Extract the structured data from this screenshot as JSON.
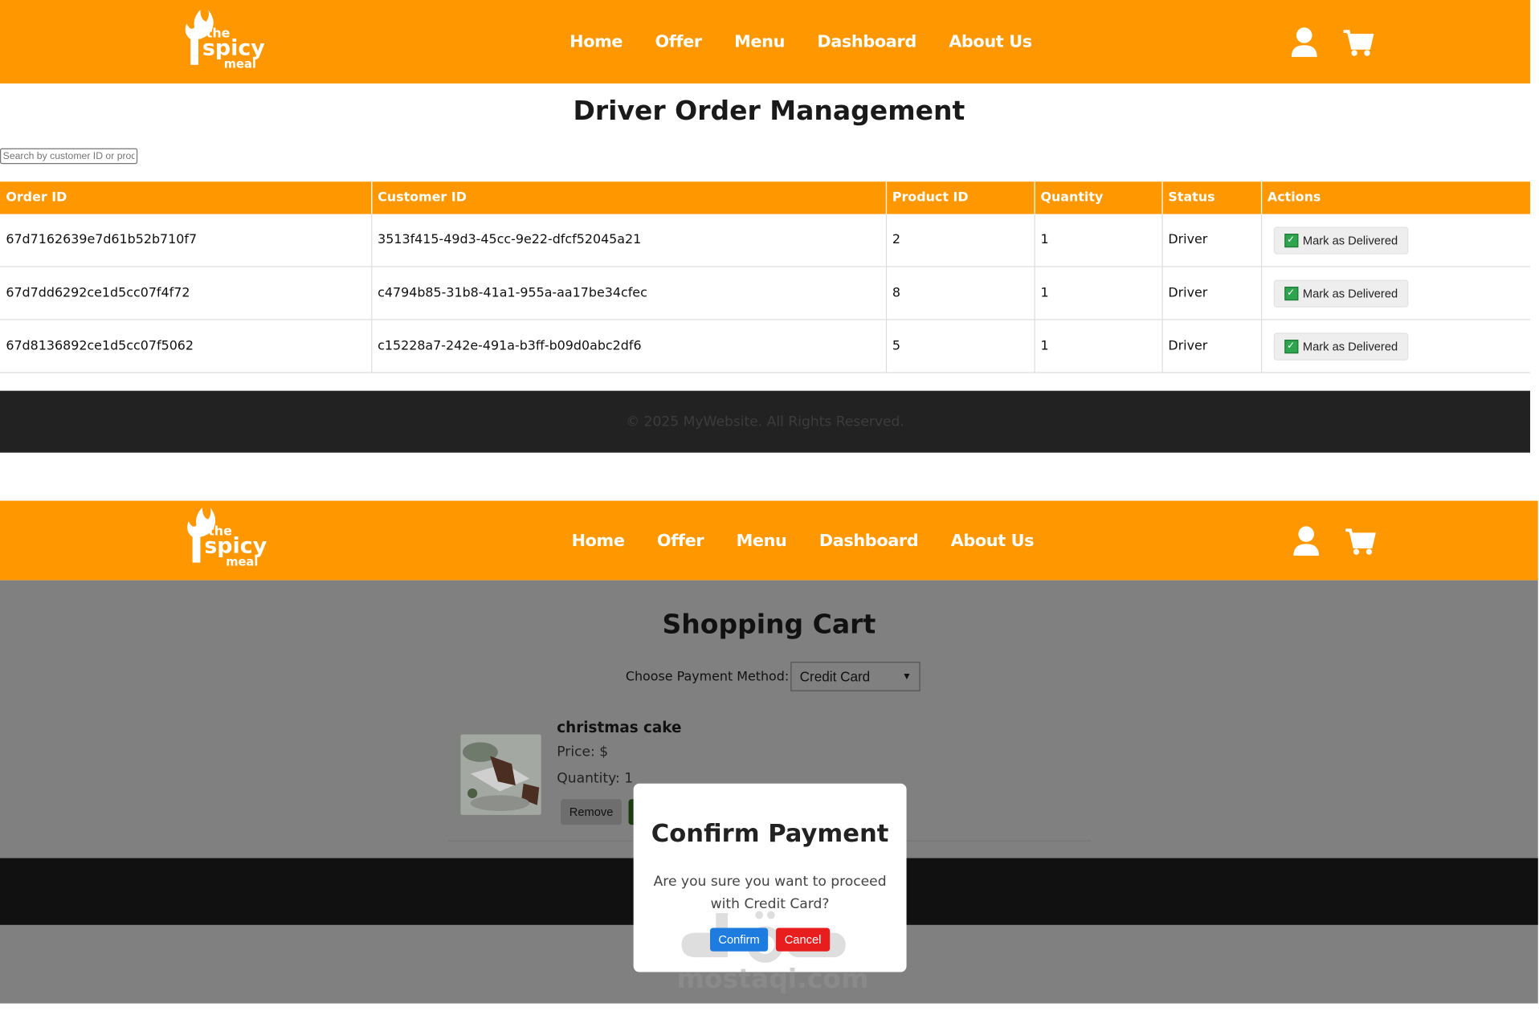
{
  "nav": {
    "links": [
      "Home",
      "Offer",
      "Menu",
      "Dashboard",
      "About Us"
    ],
    "icons": [
      "user-icon",
      "cart-icon"
    ],
    "logo": {
      "line1": "the",
      "line2": "spicy",
      "line3": "meal"
    }
  },
  "driver_page": {
    "title": "Driver Order Management",
    "search_placeholder": "Search by customer ID or product ID",
    "columns": [
      "Order ID",
      "Customer ID",
      "Product ID",
      "Quantity",
      "Status",
      "Actions"
    ],
    "rows": [
      {
        "order_id": "67d7162639e7d61b52b710f7",
        "customer_id": "3513f415-49d3-45cc-9e22-dfcf52045a21",
        "product_id": "2",
        "quantity": "1",
        "status": "Driver",
        "action": "Mark as Delivered"
      },
      {
        "order_id": "67d7dd6292ce1d5cc07f4f72",
        "customer_id": "c4794b85-31b8-41a1-955a-aa17be34cfec",
        "product_id": "8",
        "quantity": "1",
        "status": "Driver",
        "action": "Mark as Delivered"
      },
      {
        "order_id": "67d8136892ce1d5cc07f5062",
        "customer_id": "c15228a7-242e-491a-b3ff-b09d0abc2df6",
        "product_id": "5",
        "quantity": "1",
        "status": "Driver",
        "action": "Mark as Delivered"
      }
    ],
    "footer": "© 2025 MyWebsite. All Rights Reserved."
  },
  "cart_page": {
    "title": "Shopping Cart",
    "payment_label": "Choose Payment Method:",
    "payment_selected": "Credit Card",
    "item": {
      "name": "christmas cake",
      "price": "Price: $",
      "quantity": "Quantity: 1",
      "remove": "Remove"
    }
  },
  "modal": {
    "title": "Confirm Payment",
    "text": "Are you sure you want to proceed with Credit Card?",
    "confirm": "Confirm",
    "cancel": "Cancel"
  },
  "watermark": "mostaqi.com",
  "colors": {
    "brand": "#ff9800",
    "confirm": "#1e7be0",
    "cancel": "#e81e1e"
  }
}
